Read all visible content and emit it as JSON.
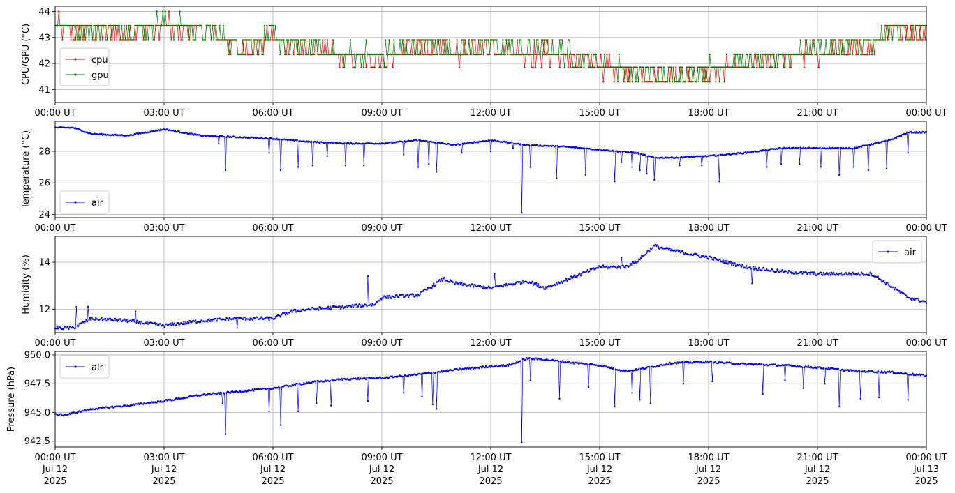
{
  "figure": {
    "xtick_labels": [
      "00:00 UT",
      "03:00 UT",
      "06:00 UT",
      "09:00 UT",
      "12:00 UT",
      "15:00 UT",
      "18:00 UT",
      "21:00 UT",
      "00:00 UT"
    ],
    "date_labels": [
      [
        "Jul 12",
        "2025"
      ],
      [
        "Jul 12",
        "2025"
      ],
      [
        "Jul 12",
        "2025"
      ],
      [
        "Jul 12",
        "2025"
      ],
      [
        "Jul 12",
        "2025"
      ],
      [
        "Jul 12",
        "2025"
      ],
      [
        "Jul 12",
        "2025"
      ],
      [
        "Jul 12",
        "2025"
      ],
      [
        "Jul 13",
        "2025"
      ]
    ]
  },
  "colors": {
    "cpu": "#ff0000",
    "gpu": "#008000",
    "air": "#0000ff",
    "grid": "#b0b0b0"
  },
  "chart_data": [
    {
      "type": "line",
      "ylabel": "CPU/GPU (°C)",
      "xlim": [
        "2025-07-12T00:00Z",
        "2025-07-13T00:00Z"
      ],
      "ylim": [
        40.5,
        44.2
      ],
      "yticks": [
        41,
        42,
        43,
        44
      ],
      "grid": true,
      "legend": "center-left",
      "series": [
        {
          "name": "cpu",
          "color": "#ff0000",
          "noise": 0.35,
          "x_hours": [
            0,
            1,
            2,
            3,
            4,
            4.6,
            5,
            6,
            7,
            8,
            9,
            10,
            11,
            12,
            13,
            14,
            15,
            16,
            17,
            18,
            19,
            20,
            21,
            22,
            22.5,
            23,
            24
          ],
          "values": [
            43.4,
            43.3,
            43.2,
            43.4,
            43.3,
            43.0,
            42.6,
            42.9,
            42.5,
            42.3,
            42.2,
            42.6,
            42.4,
            42.6,
            42.4,
            42.3,
            41.9,
            41.6,
            41.4,
            41.7,
            41.9,
            42.2,
            42.4,
            42.5,
            42.6,
            43.2,
            43.2
          ]
        },
        {
          "name": "gpu",
          "color": "#008000",
          "noise": 0.35,
          "x_hours": [
            0,
            1,
            2,
            3,
            4,
            4.6,
            5,
            6,
            7,
            8,
            9,
            10,
            11,
            12,
            13,
            14,
            15,
            16,
            17,
            18,
            19,
            20,
            21,
            22,
            22.5,
            23,
            24
          ],
          "values": [
            43.5,
            43.3,
            43.3,
            43.5,
            43.3,
            43.0,
            42.7,
            43.0,
            42.6,
            42.4,
            42.3,
            42.7,
            42.5,
            42.7,
            42.5,
            42.4,
            42.0,
            41.7,
            41.5,
            41.8,
            42.0,
            42.3,
            42.5,
            42.6,
            42.7,
            43.3,
            43.3
          ]
        }
      ]
    },
    {
      "type": "line",
      "ylabel": "Temperature (°C)",
      "xlim": [
        "2025-07-12T00:00Z",
        "2025-07-13T00:00Z"
      ],
      "ylim": [
        23.8,
        29.9
      ],
      "yticks": [
        24,
        26,
        28
      ],
      "grid": true,
      "legend": "bottom-left",
      "series": [
        {
          "name": "air",
          "color": "#0000ff",
          "noise": 0.04,
          "x_hours": [
            0,
            0.5,
            1,
            2,
            3,
            4,
            5,
            6,
            7,
            8,
            9,
            10,
            11,
            12,
            13,
            14,
            15,
            16,
            16.5,
            17,
            18,
            19,
            20,
            21,
            22,
            23,
            23.5,
            24
          ],
          "values": [
            29.5,
            29.5,
            29.1,
            29.0,
            29.4,
            29.0,
            28.9,
            28.8,
            28.6,
            28.5,
            28.5,
            28.7,
            28.4,
            28.7,
            28.4,
            28.3,
            28.1,
            27.9,
            27.6,
            27.6,
            27.7,
            27.9,
            28.2,
            28.2,
            28.2,
            28.7,
            29.2,
            29.2
          ],
          "spikes": [
            [
              4.5,
              28.5
            ],
            [
              4.7,
              26.8
            ],
            [
              5.9,
              27.9
            ],
            [
              6.2,
              26.8
            ],
            [
              6.7,
              27.0
            ],
            [
              7.1,
              27.1
            ],
            [
              7.5,
              27.7
            ],
            [
              8.0,
              27.1
            ],
            [
              8.5,
              27.1
            ],
            [
              9.6,
              27.8
            ],
            [
              10.0,
              27.0
            ],
            [
              10.3,
              27.2
            ],
            [
              10.5,
              26.7
            ],
            [
              11.2,
              27.9
            ],
            [
              12.0,
              28.0
            ],
            [
              12.6,
              28.2
            ],
            [
              12.85,
              24.1
            ],
            [
              13.1,
              27.0
            ],
            [
              13.8,
              26.3
            ],
            [
              14.6,
              26.5
            ],
            [
              15.4,
              26.1
            ],
            [
              15.6,
              27.3
            ],
            [
              15.9,
              27.0
            ],
            [
              16.1,
              26.8
            ],
            [
              16.3,
              26.6
            ],
            [
              16.5,
              26.2
            ],
            [
              17.2,
              27.1
            ],
            [
              17.8,
              27.1
            ],
            [
              18.3,
              26.1
            ],
            [
              19.6,
              27.0
            ],
            [
              20.0,
              27.2
            ],
            [
              20.5,
              27.2
            ],
            [
              21.1,
              27.0
            ],
            [
              21.6,
              26.5
            ],
            [
              22.0,
              27.0
            ],
            [
              22.4,
              26.8
            ],
            [
              22.9,
              26.9
            ],
            [
              23.5,
              27.9
            ]
          ]
        }
      ]
    },
    {
      "type": "line",
      "ylabel": "Humidity (%)",
      "xlim": [
        "2025-07-12T00:00Z",
        "2025-07-13T00:00Z"
      ],
      "ylim": [
        11.0,
        15.1
      ],
      "yticks": [
        12,
        14
      ],
      "grid": true,
      "legend": "top-right",
      "series": [
        {
          "name": "air",
          "color": "#0000ff",
          "noise": 0.07,
          "x_hours": [
            0,
            0.5,
            1,
            2,
            3,
            4,
            5,
            6,
            6.5,
            7,
            8,
            8.8,
            9,
            10,
            10.7,
            11,
            12,
            13,
            13.5,
            14,
            15,
            15.7,
            16,
            16.5,
            17,
            18,
            19,
            20,
            21,
            22,
            22.5,
            23,
            23.5,
            24
          ],
          "values": [
            11.2,
            11.2,
            11.6,
            11.5,
            11.3,
            11.5,
            11.6,
            11.6,
            11.9,
            12.0,
            12.1,
            12.2,
            12.5,
            12.6,
            13.3,
            13.1,
            12.9,
            13.2,
            12.9,
            13.2,
            13.8,
            13.8,
            14.0,
            14.7,
            14.5,
            14.2,
            13.8,
            13.6,
            13.5,
            13.5,
            13.5,
            13.0,
            12.5,
            12.3
          ],
          "spikes": [
            [
              0.6,
              12.1
            ],
            [
              0.9,
              12.1
            ],
            [
              2.2,
              11.9
            ],
            [
              5.0,
              11.2
            ],
            [
              8.6,
              13.4
            ],
            [
              12.1,
              13.5
            ],
            [
              15.6,
              14.2
            ],
            [
              19.2,
              13.1
            ]
          ]
        }
      ]
    },
    {
      "type": "line",
      "ylabel": "Pressure (hPa)",
      "xlim": [
        "2025-07-12T00:00Z",
        "2025-07-13T00:00Z"
      ],
      "ylim": [
        942.0,
        950.3
      ],
      "yticks": [
        942.5,
        945.0,
        947.5,
        950.0
      ],
      "grid": true,
      "legend": "top-left",
      "series": [
        {
          "name": "air",
          "color": "#0000ff",
          "noise": 0.08,
          "x_hours": [
            0,
            0.3,
            1,
            2,
            3,
            4,
            5,
            6,
            7,
            8,
            9,
            10,
            11,
            12,
            12.5,
            13,
            13.5,
            14,
            15,
            15.7,
            16,
            17,
            18,
            19,
            20,
            21,
            22,
            23,
            24
          ],
          "values": [
            944.8,
            944.8,
            945.3,
            945.6,
            946.0,
            946.5,
            946.8,
            947.1,
            947.6,
            947.9,
            948.0,
            948.3,
            948.7,
            949.0,
            949.1,
            949.7,
            949.6,
            949.4,
            949.1,
            948.6,
            948.7,
            949.3,
            949.4,
            949.2,
            949.1,
            948.9,
            948.6,
            948.5,
            948.2
          ],
          "spikes": [
            [
              4.6,
              945.8
            ],
            [
              4.7,
              943.1
            ],
            [
              5.9,
              945.1
            ],
            [
              6.2,
              943.9
            ],
            [
              6.7,
              945.1
            ],
            [
              7.2,
              945.8
            ],
            [
              7.6,
              945.6
            ],
            [
              8.6,
              946.0
            ],
            [
              9.6,
              946.7
            ],
            [
              10.1,
              946.4
            ],
            [
              10.4,
              945.7
            ],
            [
              10.5,
              945.3
            ],
            [
              12.85,
              942.4
            ],
            [
              13.1,
              947.8
            ],
            [
              13.9,
              946.2
            ],
            [
              14.7,
              947.2
            ],
            [
              15.4,
              945.5
            ],
            [
              15.9,
              946.7
            ],
            [
              16.1,
              946.1
            ],
            [
              16.4,
              945.8
            ],
            [
              17.3,
              947.5
            ],
            [
              18.1,
              947.7
            ],
            [
              19.5,
              946.6
            ],
            [
              20.1,
              947.8
            ],
            [
              20.6,
              947.1
            ],
            [
              21.2,
              947.5
            ],
            [
              21.6,
              945.5
            ],
            [
              22.2,
              946.2
            ],
            [
              22.7,
              946.3
            ],
            [
              23.5,
              946.1
            ]
          ]
        }
      ]
    }
  ]
}
